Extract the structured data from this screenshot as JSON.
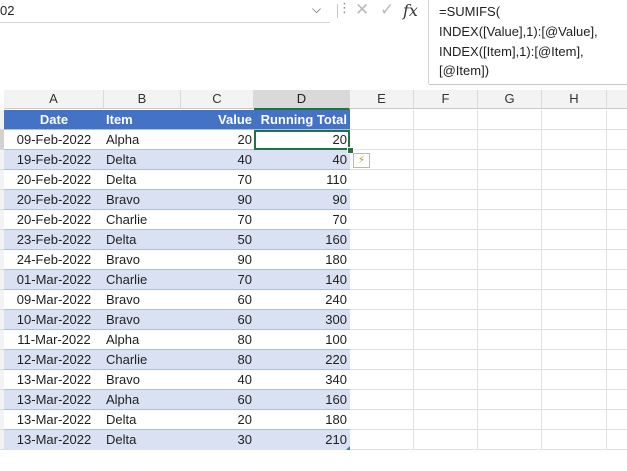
{
  "name_box": {
    "reference": "02"
  },
  "formula_bar": {
    "cancel_icon": "✕",
    "enter_icon": "✓",
    "fx_label": "fx",
    "lines": [
      "=SUMIFS(",
      "INDEX([Value],1):[@Value],",
      "INDEX([Item],1):[@Item],",
      "[@Item])"
    ]
  },
  "columns": [
    "A",
    "B",
    "C",
    "D",
    "E",
    "F",
    "G",
    "H"
  ],
  "table": {
    "headers": [
      "Date",
      "Item",
      "Value",
      "Running Total"
    ],
    "rows": [
      [
        "09-Feb-2022",
        "Alpha",
        "20",
        "20"
      ],
      [
        "19-Feb-2022",
        "Delta",
        "40",
        "40"
      ],
      [
        "20-Feb-2022",
        "Delta",
        "70",
        "110"
      ],
      [
        "20-Feb-2022",
        "Bravo",
        "90",
        "90"
      ],
      [
        "20-Feb-2022",
        "Charlie",
        "70",
        "70"
      ],
      [
        "23-Feb-2022",
        "Delta",
        "50",
        "160"
      ],
      [
        "24-Feb-2022",
        "Bravo",
        "90",
        "180"
      ],
      [
        "01-Mar-2022",
        "Charlie",
        "70",
        "140"
      ],
      [
        "09-Mar-2022",
        "Bravo",
        "60",
        "240"
      ],
      [
        "10-Mar-2022",
        "Bravo",
        "60",
        "300"
      ],
      [
        "11-Mar-2022",
        "Alpha",
        "80",
        "100"
      ],
      [
        "12-Mar-2022",
        "Charlie",
        "80",
        "220"
      ],
      [
        "13-Mar-2022",
        "Bravo",
        "40",
        "340"
      ],
      [
        "13-Mar-2022",
        "Alpha",
        "60",
        "160"
      ],
      [
        "13-Mar-2022",
        "Delta",
        "20",
        "180"
      ],
      [
        "13-Mar-2022",
        "Delta",
        "30",
        "210"
      ]
    ]
  },
  "colors": {
    "header": "#4472c4",
    "band": "#d9e1f2",
    "selection": "#217346"
  },
  "icons": {
    "autofill_options": "autofill-options-icon"
  }
}
